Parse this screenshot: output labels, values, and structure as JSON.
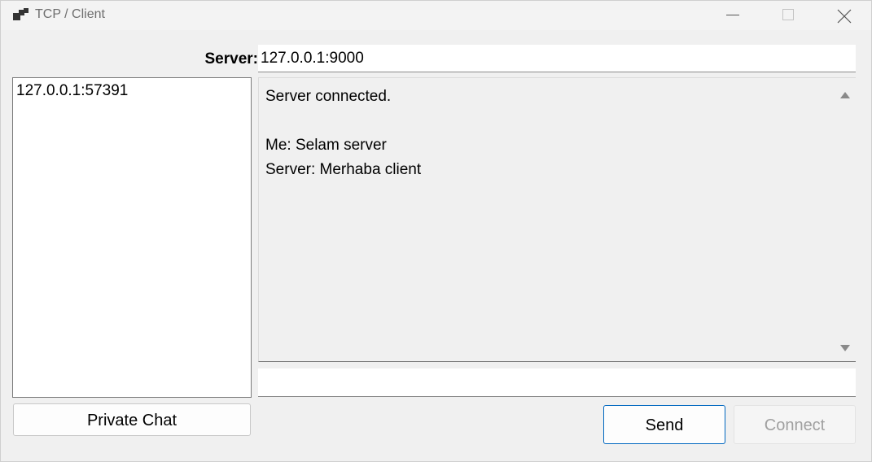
{
  "window": {
    "title": "TCP / Client"
  },
  "server": {
    "label": "Server:",
    "address": "127.0.0.1:9000"
  },
  "clients": {
    "items": [
      "127.0.0.1:57391"
    ]
  },
  "chat": {
    "lines": [
      "Server connected.",
      "",
      "Me: Selam server",
      "Server: Merhaba client"
    ]
  },
  "message": {
    "value": ""
  },
  "buttons": {
    "private_chat": "Private Chat",
    "send": "Send",
    "connect": "Connect"
  },
  "colors": {
    "accent": "#0067c0",
    "disabled_text": "#a0a0a0",
    "window_bg": "#f0f0f0"
  },
  "icons": {
    "app": "app-windows-icon",
    "minimize": "minimize-icon",
    "maximize": "maximize-icon",
    "close": "close-icon",
    "scroll_up": "scroll-up-arrow-icon",
    "scroll_down": "scroll-down-arrow-icon"
  }
}
